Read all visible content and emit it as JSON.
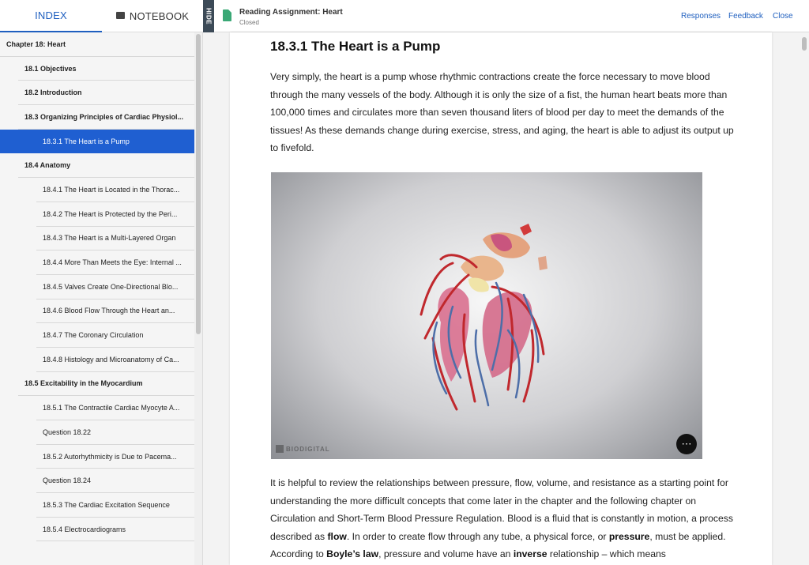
{
  "topbar": {
    "tabs": {
      "index": "INDEX",
      "notebook": "NOTEBOOK"
    },
    "hide_label": "HIDE",
    "assignment": {
      "title": "Reading Assignment: Heart",
      "status": "Closed"
    },
    "links": {
      "responses": "Responses",
      "feedback": "Feedback",
      "close": "Close"
    }
  },
  "sidebar": {
    "items": [
      {
        "label": "Chapter 18: Heart",
        "level": 0
      },
      {
        "label": "18.1 Objectives",
        "level": 1
      },
      {
        "label": "18.2 Introduction",
        "level": 1
      },
      {
        "label": "18.3 Organizing Principles of Cardiac Physiol...",
        "level": 1
      },
      {
        "label": "18.3.1 The Heart is a Pump",
        "level": 2,
        "active": true
      },
      {
        "label": "18.4 Anatomy",
        "level": 1
      },
      {
        "label": "18.4.1 The Heart is Located in the Thorac...",
        "level": 2
      },
      {
        "label": "18.4.2 The Heart is Protected by the Peri...",
        "level": 2
      },
      {
        "label": "18.4.3 The Heart is a Multi-Layered Organ",
        "level": 2
      },
      {
        "label": "18.4.4 More Than Meets the Eye: Internal ...",
        "level": 2
      },
      {
        "label": "18.4.5 Valves Create One-Directional Blo...",
        "level": 2
      },
      {
        "label": "18.4.6 Blood Flow Through the Heart an...",
        "level": 2
      },
      {
        "label": "18.4.7 The Coronary Circulation",
        "level": 2
      },
      {
        "label": "18.4.8 Histology and Microanatomy of Ca...",
        "level": 2
      },
      {
        "label": "18.5 Excitability in the Myocardium",
        "level": 1
      },
      {
        "label": "18.5.1 The Contractile Cardiac Myocyte A...",
        "level": 2
      },
      {
        "label": "Question 18.22",
        "level": 2
      },
      {
        "label": "18.5.2 Autorhythmicity is Due to Pacema...",
        "level": 2
      },
      {
        "label": "Question 18.24",
        "level": 2
      },
      {
        "label": "18.5.3 The Cardiac Excitation Sequence",
        "level": 2
      },
      {
        "label": "18.5.4 Electrocardiograms",
        "level": 2
      },
      {
        "label": "",
        "level": 2
      }
    ]
  },
  "content": {
    "heading": "18.3.1 The Heart is a Pump",
    "paragraph1": "Very simply, the heart is a pump whose rhythmic contractions create the force necessary to move blood through the many vessels of the body. Although it is only the size of a fist, the human heart beats more than 100,000 times and circulates more than seven thousand liters of blood per day to meet the demands of the tissues! As these demands change during exercise, stress, and aging, the heart is able to adjust its output up to fivefold.",
    "paragraph2": {
      "t1": "It is helpful to review the relationships between pressure, flow, volume, and resistance as a starting point for understanding the more difficult concepts that come later in the chapter and the following chapter on Circulation and Short-Term Blood Pressure Regulation. Blood is a fluid that is constantly in motion, a process described as ",
      "b1": "flow",
      "t2": ". In order to create flow through any tube, a physical force, or ",
      "b2": "pressure",
      "t3": ", must be applied. According to ",
      "b3": "Boyle’s law",
      "t4": ", pressure and volume have an ",
      "b4": "inverse",
      "t5": " relationship – which means"
    },
    "figure": {
      "watermark": "BIODIGITAL",
      "more_button": "⋯"
    }
  },
  "colors": {
    "accent": "#1f5fbf",
    "active_item": "#1f5fd1",
    "doc_icon": "#3aa876",
    "hide_tab": "#3c4a57"
  },
  "icons": {
    "notebook": "notebook-icon",
    "document": "document-icon",
    "more": "more-options-icon"
  }
}
